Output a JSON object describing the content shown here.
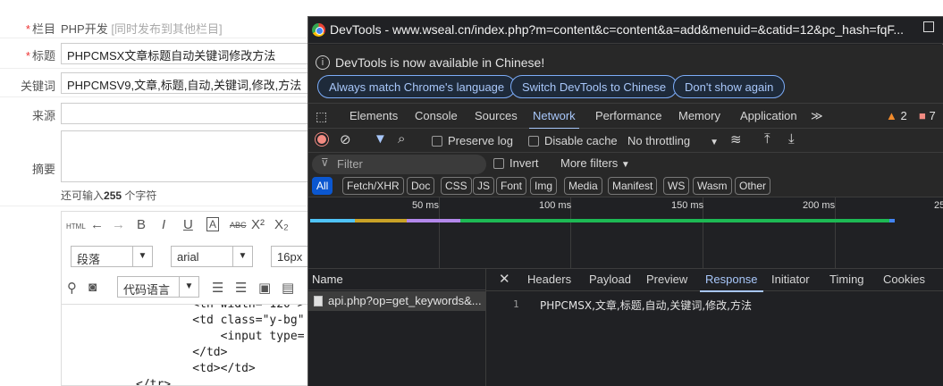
{
  "cms": {
    "fields": [
      {
        "label": "栏目",
        "required": true,
        "value": "PHP开发",
        "hint": "[同时发布到其他栏目]"
      },
      {
        "label": "标题",
        "required": true,
        "value": "PHPCMSX文章标题自动关键词修改方法"
      },
      {
        "label": "关键词",
        "required": false,
        "value": "PHPCMSV9,文章,标题,自动,关键词,修改,方法"
      },
      {
        "label": "来源",
        "required": false,
        "value": ""
      },
      {
        "label": "摘要",
        "required": false,
        "value": ""
      }
    ],
    "remaining_prefix": "还可输入",
    "remaining_count": "255",
    "remaining_suffix": " 个字符",
    "editor": {
      "format_select": "段落",
      "font_select": "arial",
      "size_select": "16px",
      "lang_select": "代码语言",
      "code_lines": [
        "    <th width=\"120\">",
        "    <td class=\"y-bg\"",
        "        <input type=",
        "    </td>",
        "    <td></td>",
        "</tr>"
      ]
    }
  },
  "devtools": {
    "window_title": "DevTools - www.wseal.cn/index.php?m=content&c=content&a=add&menuid=&catid=12&pc_hash=fqF...",
    "infobar": {
      "text": "DevTools is now available in Chinese!",
      "buttons": [
        "Always match Chrome's language",
        "Switch DevTools to Chinese",
        "Don't show again"
      ]
    },
    "tabs": [
      "Elements",
      "Console",
      "Sources",
      "Network",
      "Performance",
      "Memory",
      "Application"
    ],
    "active_tab": "Network",
    "warnings": "2",
    "errors": "7",
    "toolbar": {
      "preserve_log": "Preserve log",
      "disable_cache": "Disable cache",
      "throttling": "No throttling"
    },
    "filter": {
      "placeholder": "Filter",
      "invert": "Invert",
      "more_filters": "More filters"
    },
    "type_filters": [
      "All",
      "Fetch/XHR",
      "Doc",
      "CSS",
      "JS",
      "Font",
      "Img",
      "Media",
      "Manifest",
      "WS",
      "Wasm",
      "Other"
    ],
    "active_type": "All",
    "timeline_ticks": [
      "50 ms",
      "100 ms",
      "150 ms",
      "200 ms",
      "25"
    ],
    "name_header": "Name",
    "request_name": "api.php?op=get_keywords&...",
    "detail_tabs": [
      "Headers",
      "Payload",
      "Preview",
      "Response",
      "Initiator",
      "Timing",
      "Cookies"
    ],
    "active_detail_tab": "Response",
    "response_line_number": "1",
    "response_text": "PHPCMSX,文章,标题,自动,关键词,修改,方法"
  }
}
